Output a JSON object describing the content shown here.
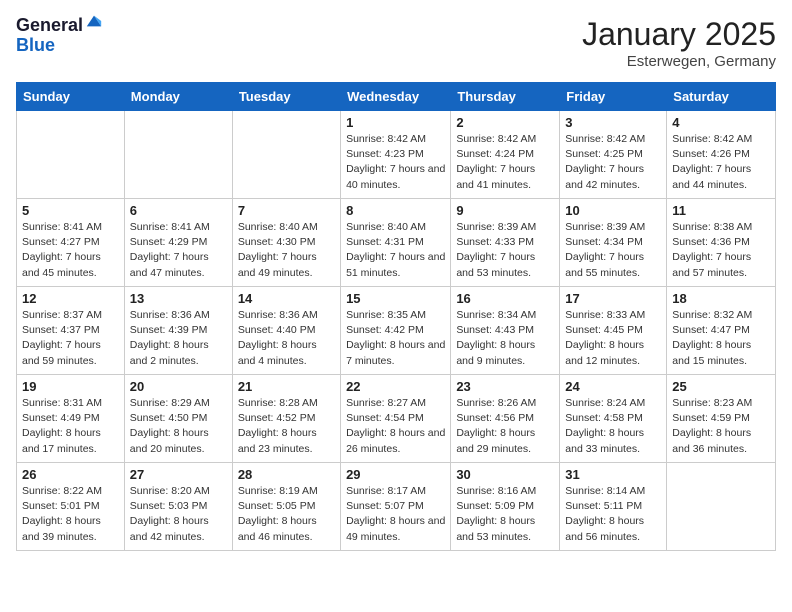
{
  "logo": {
    "general": "General",
    "blue": "Blue"
  },
  "title": "January 2025",
  "location": "Esterwegen, Germany",
  "weekdays": [
    "Sunday",
    "Monday",
    "Tuesday",
    "Wednesday",
    "Thursday",
    "Friday",
    "Saturday"
  ],
  "weeks": [
    [
      {
        "day": "",
        "sunrise": "",
        "sunset": "",
        "daylight": ""
      },
      {
        "day": "",
        "sunrise": "",
        "sunset": "",
        "daylight": ""
      },
      {
        "day": "",
        "sunrise": "",
        "sunset": "",
        "daylight": ""
      },
      {
        "day": "1",
        "sunrise": "Sunrise: 8:42 AM",
        "sunset": "Sunset: 4:23 PM",
        "daylight": "Daylight: 7 hours and 40 minutes."
      },
      {
        "day": "2",
        "sunrise": "Sunrise: 8:42 AM",
        "sunset": "Sunset: 4:24 PM",
        "daylight": "Daylight: 7 hours and 41 minutes."
      },
      {
        "day": "3",
        "sunrise": "Sunrise: 8:42 AM",
        "sunset": "Sunset: 4:25 PM",
        "daylight": "Daylight: 7 hours and 42 minutes."
      },
      {
        "day": "4",
        "sunrise": "Sunrise: 8:42 AM",
        "sunset": "Sunset: 4:26 PM",
        "daylight": "Daylight: 7 hours and 44 minutes."
      }
    ],
    [
      {
        "day": "5",
        "sunrise": "Sunrise: 8:41 AM",
        "sunset": "Sunset: 4:27 PM",
        "daylight": "Daylight: 7 hours and 45 minutes."
      },
      {
        "day": "6",
        "sunrise": "Sunrise: 8:41 AM",
        "sunset": "Sunset: 4:29 PM",
        "daylight": "Daylight: 7 hours and 47 minutes."
      },
      {
        "day": "7",
        "sunrise": "Sunrise: 8:40 AM",
        "sunset": "Sunset: 4:30 PM",
        "daylight": "Daylight: 7 hours and 49 minutes."
      },
      {
        "day": "8",
        "sunrise": "Sunrise: 8:40 AM",
        "sunset": "Sunset: 4:31 PM",
        "daylight": "Daylight: 7 hours and 51 minutes."
      },
      {
        "day": "9",
        "sunrise": "Sunrise: 8:39 AM",
        "sunset": "Sunset: 4:33 PM",
        "daylight": "Daylight: 7 hours and 53 minutes."
      },
      {
        "day": "10",
        "sunrise": "Sunrise: 8:39 AM",
        "sunset": "Sunset: 4:34 PM",
        "daylight": "Daylight: 7 hours and 55 minutes."
      },
      {
        "day": "11",
        "sunrise": "Sunrise: 8:38 AM",
        "sunset": "Sunset: 4:36 PM",
        "daylight": "Daylight: 7 hours and 57 minutes."
      }
    ],
    [
      {
        "day": "12",
        "sunrise": "Sunrise: 8:37 AM",
        "sunset": "Sunset: 4:37 PM",
        "daylight": "Daylight: 7 hours and 59 minutes."
      },
      {
        "day": "13",
        "sunrise": "Sunrise: 8:36 AM",
        "sunset": "Sunset: 4:39 PM",
        "daylight": "Daylight: 8 hours and 2 minutes."
      },
      {
        "day": "14",
        "sunrise": "Sunrise: 8:36 AM",
        "sunset": "Sunset: 4:40 PM",
        "daylight": "Daylight: 8 hours and 4 minutes."
      },
      {
        "day": "15",
        "sunrise": "Sunrise: 8:35 AM",
        "sunset": "Sunset: 4:42 PM",
        "daylight": "Daylight: 8 hours and 7 minutes."
      },
      {
        "day": "16",
        "sunrise": "Sunrise: 8:34 AM",
        "sunset": "Sunset: 4:43 PM",
        "daylight": "Daylight: 8 hours and 9 minutes."
      },
      {
        "day": "17",
        "sunrise": "Sunrise: 8:33 AM",
        "sunset": "Sunset: 4:45 PM",
        "daylight": "Daylight: 8 hours and 12 minutes."
      },
      {
        "day": "18",
        "sunrise": "Sunrise: 8:32 AM",
        "sunset": "Sunset: 4:47 PM",
        "daylight": "Daylight: 8 hours and 15 minutes."
      }
    ],
    [
      {
        "day": "19",
        "sunrise": "Sunrise: 8:31 AM",
        "sunset": "Sunset: 4:49 PM",
        "daylight": "Daylight: 8 hours and 17 minutes."
      },
      {
        "day": "20",
        "sunrise": "Sunrise: 8:29 AM",
        "sunset": "Sunset: 4:50 PM",
        "daylight": "Daylight: 8 hours and 20 minutes."
      },
      {
        "day": "21",
        "sunrise": "Sunrise: 8:28 AM",
        "sunset": "Sunset: 4:52 PM",
        "daylight": "Daylight: 8 hours and 23 minutes."
      },
      {
        "day": "22",
        "sunrise": "Sunrise: 8:27 AM",
        "sunset": "Sunset: 4:54 PM",
        "daylight": "Daylight: 8 hours and 26 minutes."
      },
      {
        "day": "23",
        "sunrise": "Sunrise: 8:26 AM",
        "sunset": "Sunset: 4:56 PM",
        "daylight": "Daylight: 8 hours and 29 minutes."
      },
      {
        "day": "24",
        "sunrise": "Sunrise: 8:24 AM",
        "sunset": "Sunset: 4:58 PM",
        "daylight": "Daylight: 8 hours and 33 minutes."
      },
      {
        "day": "25",
        "sunrise": "Sunrise: 8:23 AM",
        "sunset": "Sunset: 4:59 PM",
        "daylight": "Daylight: 8 hours and 36 minutes."
      }
    ],
    [
      {
        "day": "26",
        "sunrise": "Sunrise: 8:22 AM",
        "sunset": "Sunset: 5:01 PM",
        "daylight": "Daylight: 8 hours and 39 minutes."
      },
      {
        "day": "27",
        "sunrise": "Sunrise: 8:20 AM",
        "sunset": "Sunset: 5:03 PM",
        "daylight": "Daylight: 8 hours and 42 minutes."
      },
      {
        "day": "28",
        "sunrise": "Sunrise: 8:19 AM",
        "sunset": "Sunset: 5:05 PM",
        "daylight": "Daylight: 8 hours and 46 minutes."
      },
      {
        "day": "29",
        "sunrise": "Sunrise: 8:17 AM",
        "sunset": "Sunset: 5:07 PM",
        "daylight": "Daylight: 8 hours and 49 minutes."
      },
      {
        "day": "30",
        "sunrise": "Sunrise: 8:16 AM",
        "sunset": "Sunset: 5:09 PM",
        "daylight": "Daylight: 8 hours and 53 minutes."
      },
      {
        "day": "31",
        "sunrise": "Sunrise: 8:14 AM",
        "sunset": "Sunset: 5:11 PM",
        "daylight": "Daylight: 8 hours and 56 minutes."
      },
      {
        "day": "",
        "sunrise": "",
        "sunset": "",
        "daylight": ""
      }
    ]
  ]
}
